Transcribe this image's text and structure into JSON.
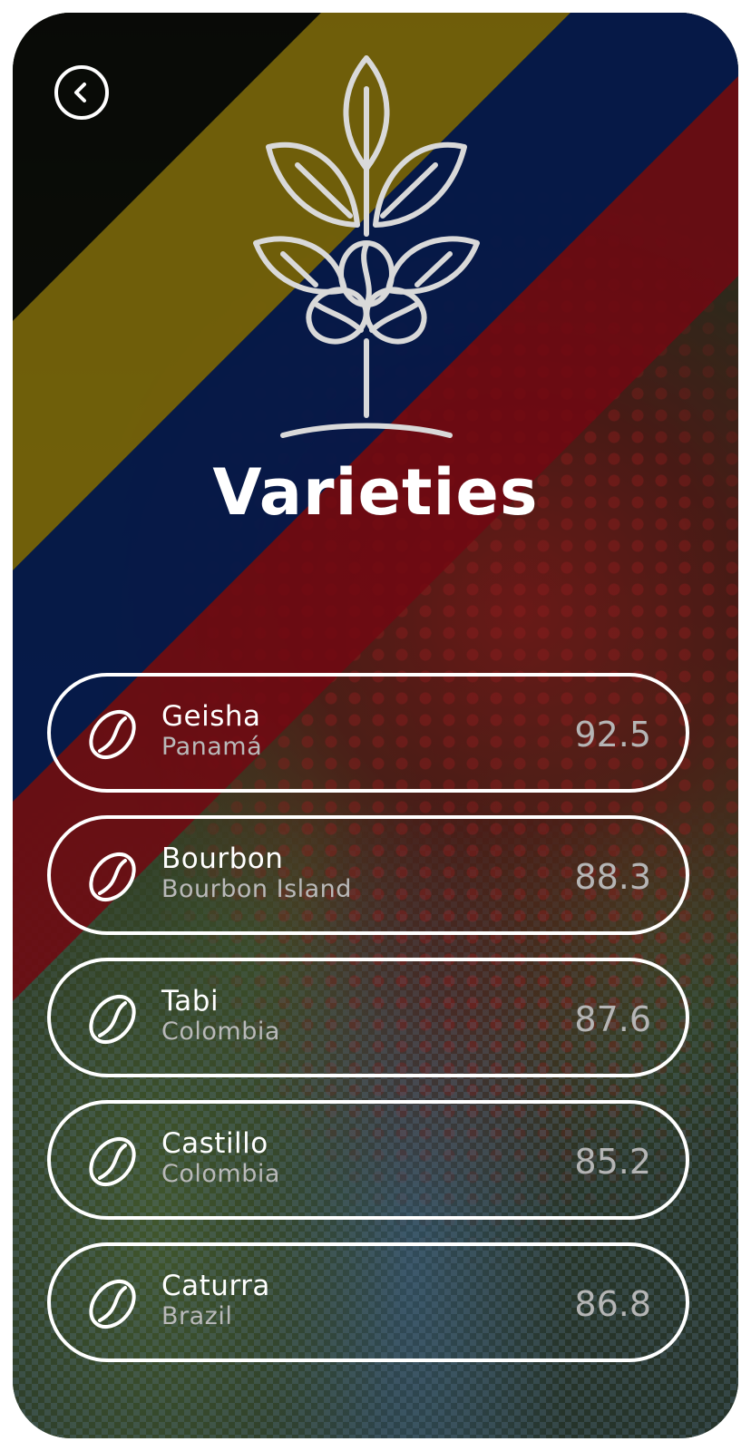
{
  "header": {
    "title": "Varieties",
    "back_icon": "chevron-left-icon",
    "hero_icon": "coffee-plant-icon"
  },
  "flag_colors": {
    "yellow": "#7a6508",
    "blue": "#04184a",
    "red": "#720812"
  },
  "varieties": [
    {
      "name": "Geisha",
      "origin": "Panamá",
      "score": "92.5",
      "icon": "coffee-bean-icon"
    },
    {
      "name": "Bourbon",
      "origin": "Bourbon Island",
      "score": "88.3",
      "icon": "coffee-bean-icon"
    },
    {
      "name": "Tabi",
      "origin": "Colombia",
      "score": "87.6",
      "icon": "coffee-bean-icon"
    },
    {
      "name": "Castillo",
      "origin": "Colombia",
      "score": "85.2",
      "icon": "coffee-bean-icon"
    },
    {
      "name": "Caturra",
      "origin": "Brazil",
      "score": "86.8",
      "icon": "coffee-bean-icon"
    }
  ]
}
